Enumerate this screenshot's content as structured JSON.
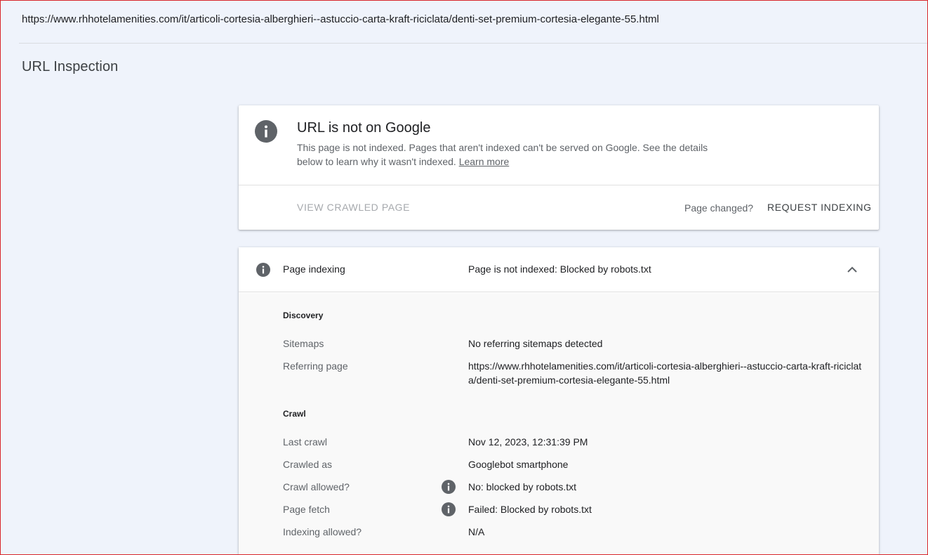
{
  "url": "https://www.rhhotelamenities.com/it/articoli-cortesia-alberghieri--astuccio-carta-kraft-riciclata/denti-set-premium-cortesia-elegante-55.html",
  "page_title": "URL Inspection",
  "status": {
    "icon": "info-icon",
    "heading": "URL is not on Google",
    "description": "This page is not indexed. Pages that aren't indexed can't be served on Google. See the details below to learn why it wasn't indexed.",
    "learn_more": "Learn more",
    "view_crawled": "VIEW CRAWLED PAGE",
    "page_changed": "Page changed?",
    "request_indexing": "REQUEST INDEXING"
  },
  "indexing": {
    "label": "Page indexing",
    "value": "Page is not indexed: Blocked by robots.txt",
    "discovery": {
      "title": "Discovery",
      "sitemaps_label": "Sitemaps",
      "sitemaps_value": "No referring sitemaps detected",
      "referring_label": "Referring page",
      "referring_value": "https://www.rhhotelamenities.com/it/articoli-cortesia-alberghieri--astuccio-carta-kraft-riciclata/denti-set-premium-cortesia-elegante-55.html"
    },
    "crawl": {
      "title": "Crawl",
      "last_crawl_label": "Last crawl",
      "last_crawl_value": "Nov 12, 2023, 12:31:39 PM",
      "crawled_as_label": "Crawled as",
      "crawled_as_value": "Googlebot smartphone",
      "crawl_allowed_label": "Crawl allowed?",
      "crawl_allowed_value": "No: blocked by robots.txt",
      "page_fetch_label": "Page fetch",
      "page_fetch_value": "Failed: Blocked by robots.txt",
      "indexing_allowed_label": "Indexing allowed?",
      "indexing_allowed_value": "N/A"
    }
  },
  "colors": {
    "background": "#eff3fb",
    "icon_gray": "#5f6368",
    "frame_border": "#d8262b"
  }
}
